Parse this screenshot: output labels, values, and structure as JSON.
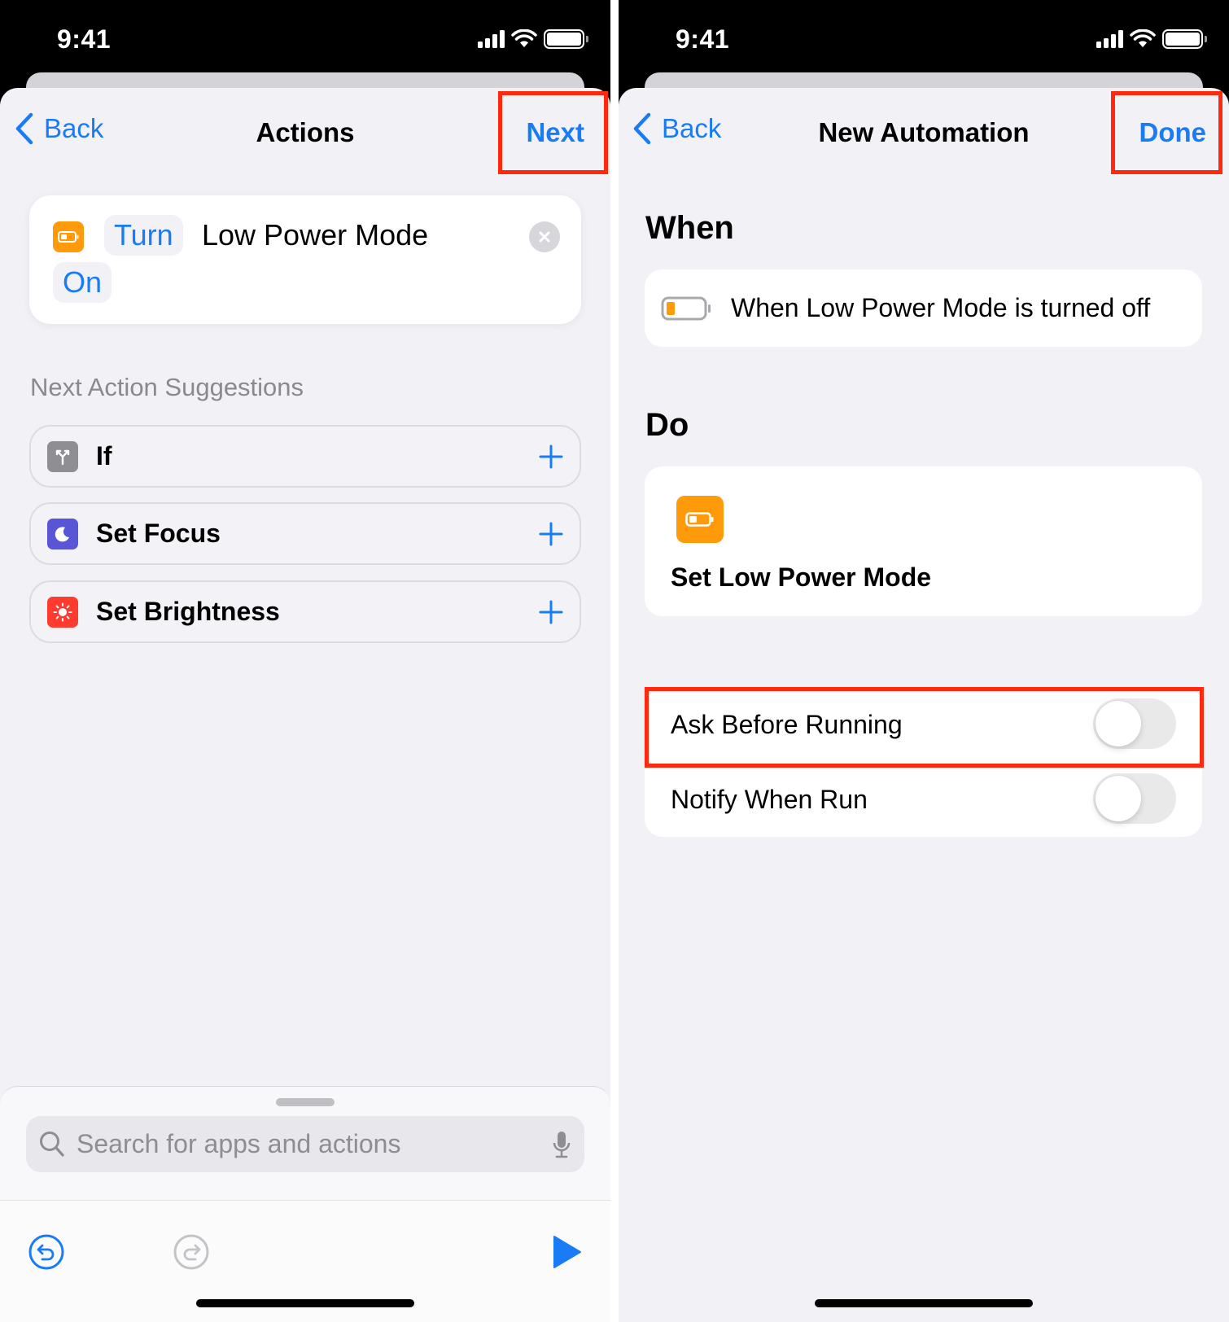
{
  "colors": {
    "accent": "#1a7cf5",
    "highlight": "#ff2a0e",
    "orange_icon": "#ff9b0a",
    "if_icon": "#8e8e93",
    "focus_icon": "#5856d6",
    "brightness_icon": "#ff3b30"
  },
  "left": {
    "status": {
      "time": "9:41"
    },
    "nav": {
      "back_label": "Back",
      "title": "Actions",
      "right_label": "Next"
    },
    "action_card": {
      "verb_token": "Turn",
      "subject": "Low Power Mode",
      "state_token": "On",
      "icon": "battery-icon"
    },
    "suggestions": {
      "header": "Next Action Suggestions",
      "items": [
        {
          "label": "If",
          "icon": "branch-icon"
        },
        {
          "label": "Set Focus",
          "icon": "moon-icon"
        },
        {
          "label": "Set Brightness",
          "icon": "sun-icon"
        }
      ]
    },
    "search": {
      "placeholder": "Search for apps and actions",
      "value": ""
    },
    "toolbar": {
      "undo": "undo-icon",
      "redo": "redo-icon",
      "run": "play-icon"
    }
  },
  "right": {
    "status": {
      "time": "9:41"
    },
    "nav": {
      "back_label": "Back",
      "title": "New Automation",
      "right_label": "Done"
    },
    "when": {
      "header": "When",
      "trigger": "When Low Power Mode is turned off"
    },
    "do": {
      "header": "Do",
      "action": "Set Low Power Mode"
    },
    "settings": [
      {
        "label": "Ask Before Running",
        "enabled": false
      },
      {
        "label": "Notify When Run",
        "enabled": false
      }
    ]
  }
}
